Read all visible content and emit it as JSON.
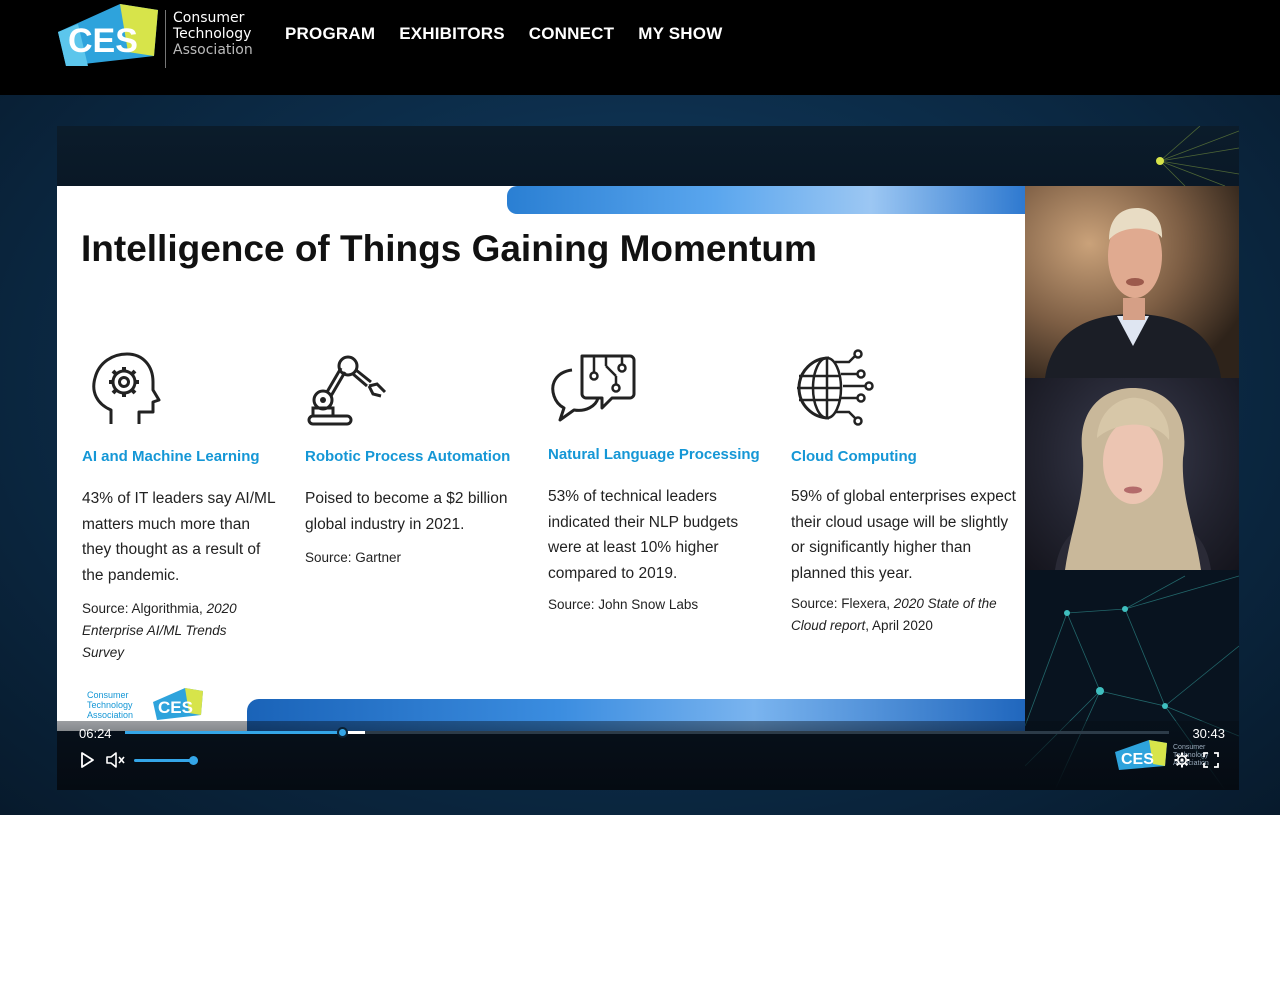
{
  "brand": {
    "logo_mark": "CES",
    "logo_line1": "Consumer",
    "logo_line2": "Technology",
    "logo_line3": "Association"
  },
  "nav": {
    "items": [
      {
        "label": "PROGRAM"
      },
      {
        "label": "EXHIBITORS"
      },
      {
        "label": "CONNECT"
      },
      {
        "label": "MY SHOW"
      }
    ]
  },
  "slide": {
    "title": "Intelligence of Things Gaining Momentum",
    "columns": [
      {
        "icon": "head-gear-icon",
        "heading": "AI and Machine Learning",
        "body": "43% of IT leaders say AI/ML matters much more than they thought as a result of the pandemic.",
        "source_prefix": "Source: Algorithmia, ",
        "source_italic": "2020 Enterprise AI/ML Trends Survey",
        "source_suffix": ""
      },
      {
        "icon": "robot-arm-icon",
        "heading": "Robotic Process Automation",
        "body": "Poised to become a $2 billion global industry in 2021.",
        "source_prefix": "Source: Gartner",
        "source_italic": "",
        "source_suffix": ""
      },
      {
        "icon": "chat-circuit-icon",
        "heading": "Natural Language Processing",
        "body": "53% of technical leaders indicated their NLP budgets were at least 10% higher compared to 2019.",
        "source_prefix": "Source: John Snow Labs",
        "source_italic": "",
        "source_suffix": ""
      },
      {
        "icon": "globe-network-icon",
        "heading": "Cloud Computing",
        "body": "59% of global enterprises expect their cloud usage will be slightly or significantly higher than planned this year.",
        "source_prefix": "Source: Flexera, ",
        "source_italic": "2020 State of the Cloud report",
        "source_suffix": ", April 2020"
      }
    ],
    "footer_logo_line1": "Consumer",
    "footer_logo_line2": "Technology",
    "footer_logo_line3": "Association",
    "footer_logo_mark": "CES"
  },
  "player": {
    "current_time": "06:24",
    "total_time": "30:43",
    "progress_fraction": 0.208,
    "buffered_fraction": 0.23,
    "volume_fraction": 1.0,
    "logo_mark": "CES",
    "logo_text": "Consumer Technology Association"
  },
  "colors": {
    "accent": "#34a6e8",
    "slide_heading": "#1597d6",
    "nav_bg": "#000000"
  }
}
